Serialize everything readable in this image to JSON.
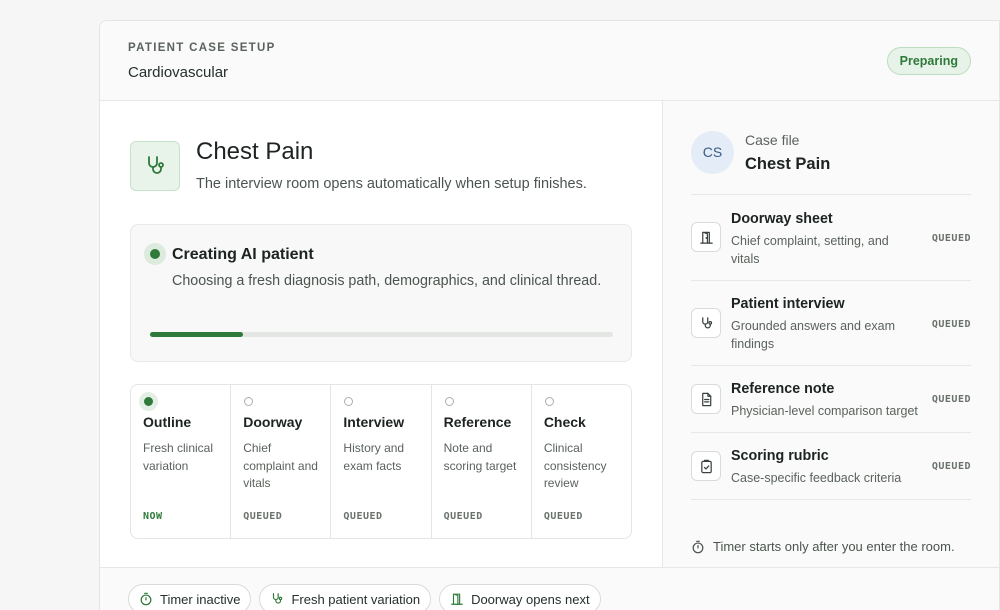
{
  "header": {
    "eyebrow": "PATIENT CASE SETUP",
    "specialty": "Cardiovascular",
    "status": "Preparing"
  },
  "case": {
    "icon": "stethoscope-icon",
    "title": "Chest Pain",
    "subtitle": "The interview room opens automatically when setup finishes."
  },
  "progress": {
    "title": "Creating AI patient",
    "description": "Choosing a fresh diagnosis path, demographics, and clinical thread.",
    "fraction": 0.2
  },
  "stages": [
    {
      "name": "Outline",
      "description": "Fresh clinical variation",
      "status": "NOW",
      "active": true
    },
    {
      "name": "Doorway",
      "description": "Chief complaint and vitals",
      "status": "QUEUED",
      "active": false
    },
    {
      "name": "Interview",
      "description": "History and exam facts",
      "status": "QUEUED",
      "active": false
    },
    {
      "name": "Reference",
      "description": "Note and scoring target",
      "status": "QUEUED",
      "active": false
    },
    {
      "name": "Check",
      "description": "Clinical consistency review",
      "status": "QUEUED",
      "active": false
    }
  ],
  "case_file": {
    "avatar": "CS",
    "label": "Case file",
    "title": "Chest Pain",
    "items": [
      {
        "icon": "door-icon",
        "title": "Doorway sheet",
        "description": "Chief complaint, setting, and vitals",
        "status": "QUEUED"
      },
      {
        "icon": "stethoscope-icon",
        "title": "Patient interview",
        "description": "Grounded answers and exam findings",
        "status": "QUEUED"
      },
      {
        "icon": "document-icon",
        "title": "Reference note",
        "description": "Physician-level comparison target",
        "status": "QUEUED"
      },
      {
        "icon": "clipboard-check-icon",
        "title": "Scoring rubric",
        "description": "Case-specific feedback criteria",
        "status": "QUEUED"
      }
    ],
    "timer_note": "Timer starts only after you enter the room."
  },
  "footer": {
    "chips": [
      {
        "icon": "timer-icon",
        "label": "Timer inactive"
      },
      {
        "icon": "stethoscope-icon",
        "label": "Fresh patient variation"
      },
      {
        "icon": "door-icon",
        "label": "Doorway opens next"
      }
    ]
  },
  "colors": {
    "accent": "#2f7a3a",
    "accent_soft": "#e8f4e9",
    "avatar_bg": "#e4ecf7"
  }
}
